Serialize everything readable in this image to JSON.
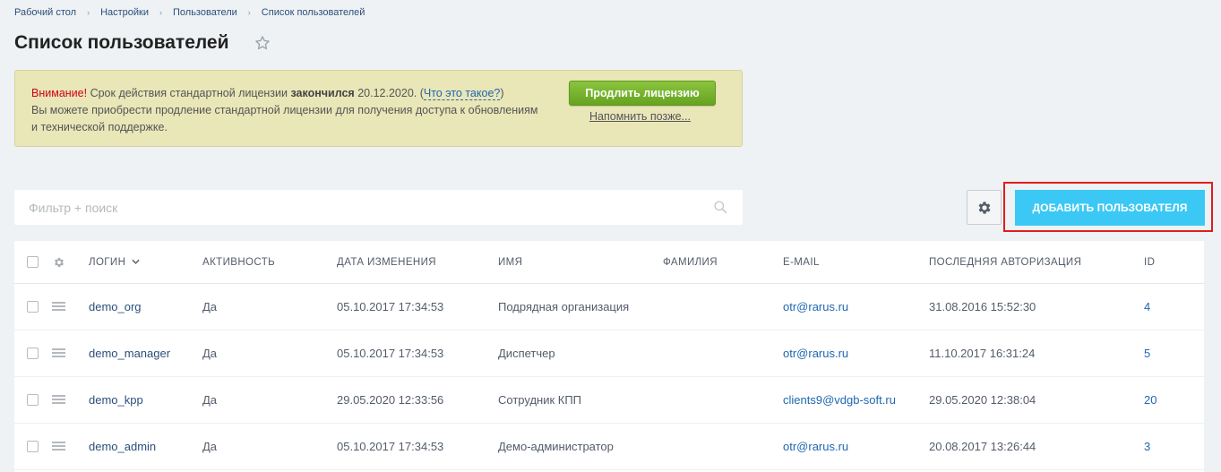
{
  "breadcrumb": {
    "items": [
      "Рабочий стол",
      "Настройки",
      "Пользователи",
      "Список пользователей"
    ],
    "separator": "›"
  },
  "page": {
    "title": "Список пользователей"
  },
  "license": {
    "warning": "Внимание!",
    "text1": " Срок действия стандартной лицензии ",
    "bold": "закончился",
    "text2": " 20.12.2020. (",
    "what_link": "Что это такое?",
    "text3": ")",
    "line2": "Вы можете приобрести продление стандартной лицензии для получения доступа к обновлениям и технической поддержке.",
    "renew_button": "Продлить лицензию",
    "remind_link": "Напомнить позже..."
  },
  "filter": {
    "placeholder": "Фильтр + поиск"
  },
  "toolbar": {
    "add_button": "ДОБАВИТЬ ПОЛЬЗОВАТЕЛЯ"
  },
  "grid": {
    "columns": {
      "login": "ЛОГИН",
      "active": "АКТИВНОСТЬ",
      "date": "ДАТА ИЗМЕНЕНИЯ",
      "name": "ИМЯ",
      "surname": "ФАМИЛИЯ",
      "email": "E-MAIL",
      "last_auth": "ПОСЛЕДНЯЯ АВТОРИЗАЦИЯ",
      "id": "ID"
    },
    "rows": [
      {
        "login": "demo_org",
        "active": "Да",
        "date": "05.10.2017 17:34:53",
        "name": "Подрядная организация",
        "surname": "",
        "email": "otr@rarus.ru",
        "last_auth": "31.08.2016 15:52:30",
        "id": "4"
      },
      {
        "login": "demo_manager",
        "active": "Да",
        "date": "05.10.2017 17:34:53",
        "name": "Диспетчер",
        "surname": "",
        "email": "otr@rarus.ru",
        "last_auth": "11.10.2017 16:31:24",
        "id": "5"
      },
      {
        "login": "demo_kpp",
        "active": "Да",
        "date": "29.05.2020 12:33:56",
        "name": "Сотрудник КПП",
        "surname": "",
        "email": "clients9@vdgb-soft.ru",
        "last_auth": "29.05.2020 12:38:04",
        "id": "20"
      },
      {
        "login": "demo_admin",
        "active": "Да",
        "date": "05.10.2017 17:34:53",
        "name": "Демо-администратор",
        "surname": "",
        "email": "otr@rarus.ru",
        "last_auth": "20.08.2017 13:26:44",
        "id": "3"
      }
    ]
  },
  "colors": {
    "background": "#eef2f4",
    "accent_button": "#3bc8f5",
    "renew_button": "#7ab52f",
    "highlight_border": "#e11d1d",
    "link": "#2067b0"
  }
}
